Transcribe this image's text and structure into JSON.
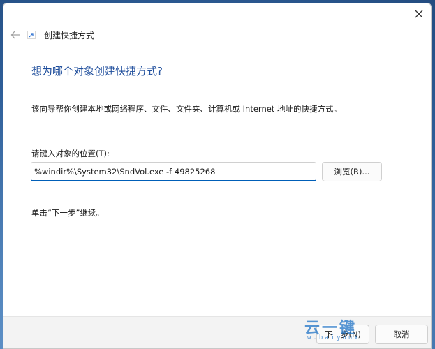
{
  "window": {
    "close_icon": "close-icon"
  },
  "header": {
    "back_icon": "back-arrow-icon",
    "wizard_icon": "shortcut-icon",
    "title": "创建快捷方式"
  },
  "main": {
    "heading": "想为哪个对象创建快捷方式?",
    "description": "该向导帮你创建本地或网络程序、文件、文件夹、计算机或 Internet 地址的快捷方式。",
    "location_label": "请键入对象的位置(T):",
    "location_value": "%windir%\\System32\\SndVol.exe -f 49825268",
    "browse_label": "浏览(R)...",
    "hint": "单击“下一步”继续。"
  },
  "footer": {
    "next_label": "下一步(N)",
    "cancel_label": "取消"
  },
  "watermark": {
    "logo": "云一键",
    "url": "w.baiyunx"
  },
  "colors": {
    "heading": "#1f4e9c",
    "accent": "#005fb8",
    "watermark": "#2878c8"
  }
}
